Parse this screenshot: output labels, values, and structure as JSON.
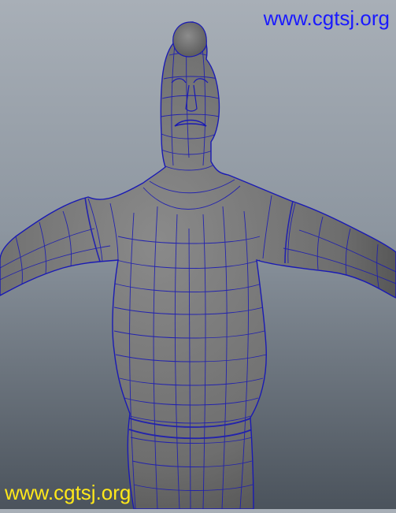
{
  "scene": {
    "subject": "character-mesh",
    "mesh_color": "#767676",
    "wire_color": "#1a1ab4",
    "bg_top": "#a8afb7",
    "bg_bottom": "#4b535c"
  },
  "watermarks": {
    "top": {
      "text": "www.cgtsj.org",
      "color": "#1a1aff"
    },
    "bottom": {
      "text": "www.cgtsj.org",
      "color": "#ffe81a"
    }
  }
}
